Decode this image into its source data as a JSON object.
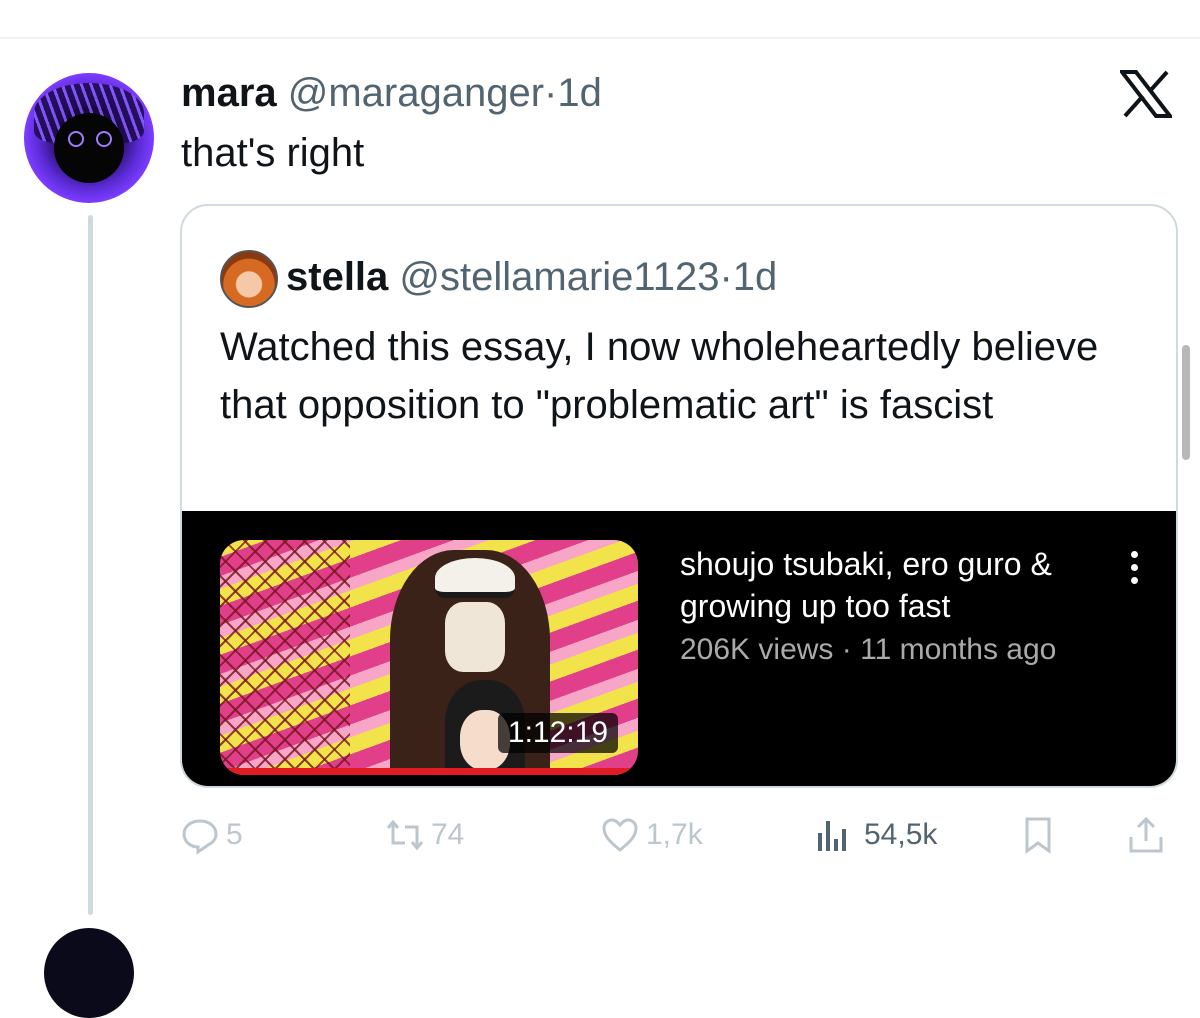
{
  "tweet": {
    "author_name": "mara",
    "author_handle": "@maraganger",
    "separator": "·",
    "time": "1d",
    "text": "that's right"
  },
  "quoted_tweet": {
    "author_name": "stella",
    "author_handle": "@stellamarie1123",
    "separator": "·",
    "time": "1d",
    "text": "Watched this essay, I now wholeheartedly believe that opposition to \"problematic art\" is fascist",
    "video": {
      "title": "shoujo tsubaki, ero guro & growing up too fast",
      "views": "206K views",
      "separator": "·",
      "age": "11 months ago",
      "duration": "1:12:19"
    }
  },
  "actions": {
    "replies": "5",
    "reposts": "74",
    "likes": "1,7k",
    "views": "54,5k"
  },
  "colors": {
    "muted": "#536471",
    "faded_icon": "#bcc6cd",
    "border": "#cfd9de",
    "video_bg": "#000000",
    "progress_red": "#e01b24"
  },
  "icons": [
    "x-logo-icon",
    "reply-icon",
    "repost-icon",
    "like-icon",
    "views-icon",
    "bookmark-icon",
    "share-icon",
    "more-vertical-icon"
  ]
}
